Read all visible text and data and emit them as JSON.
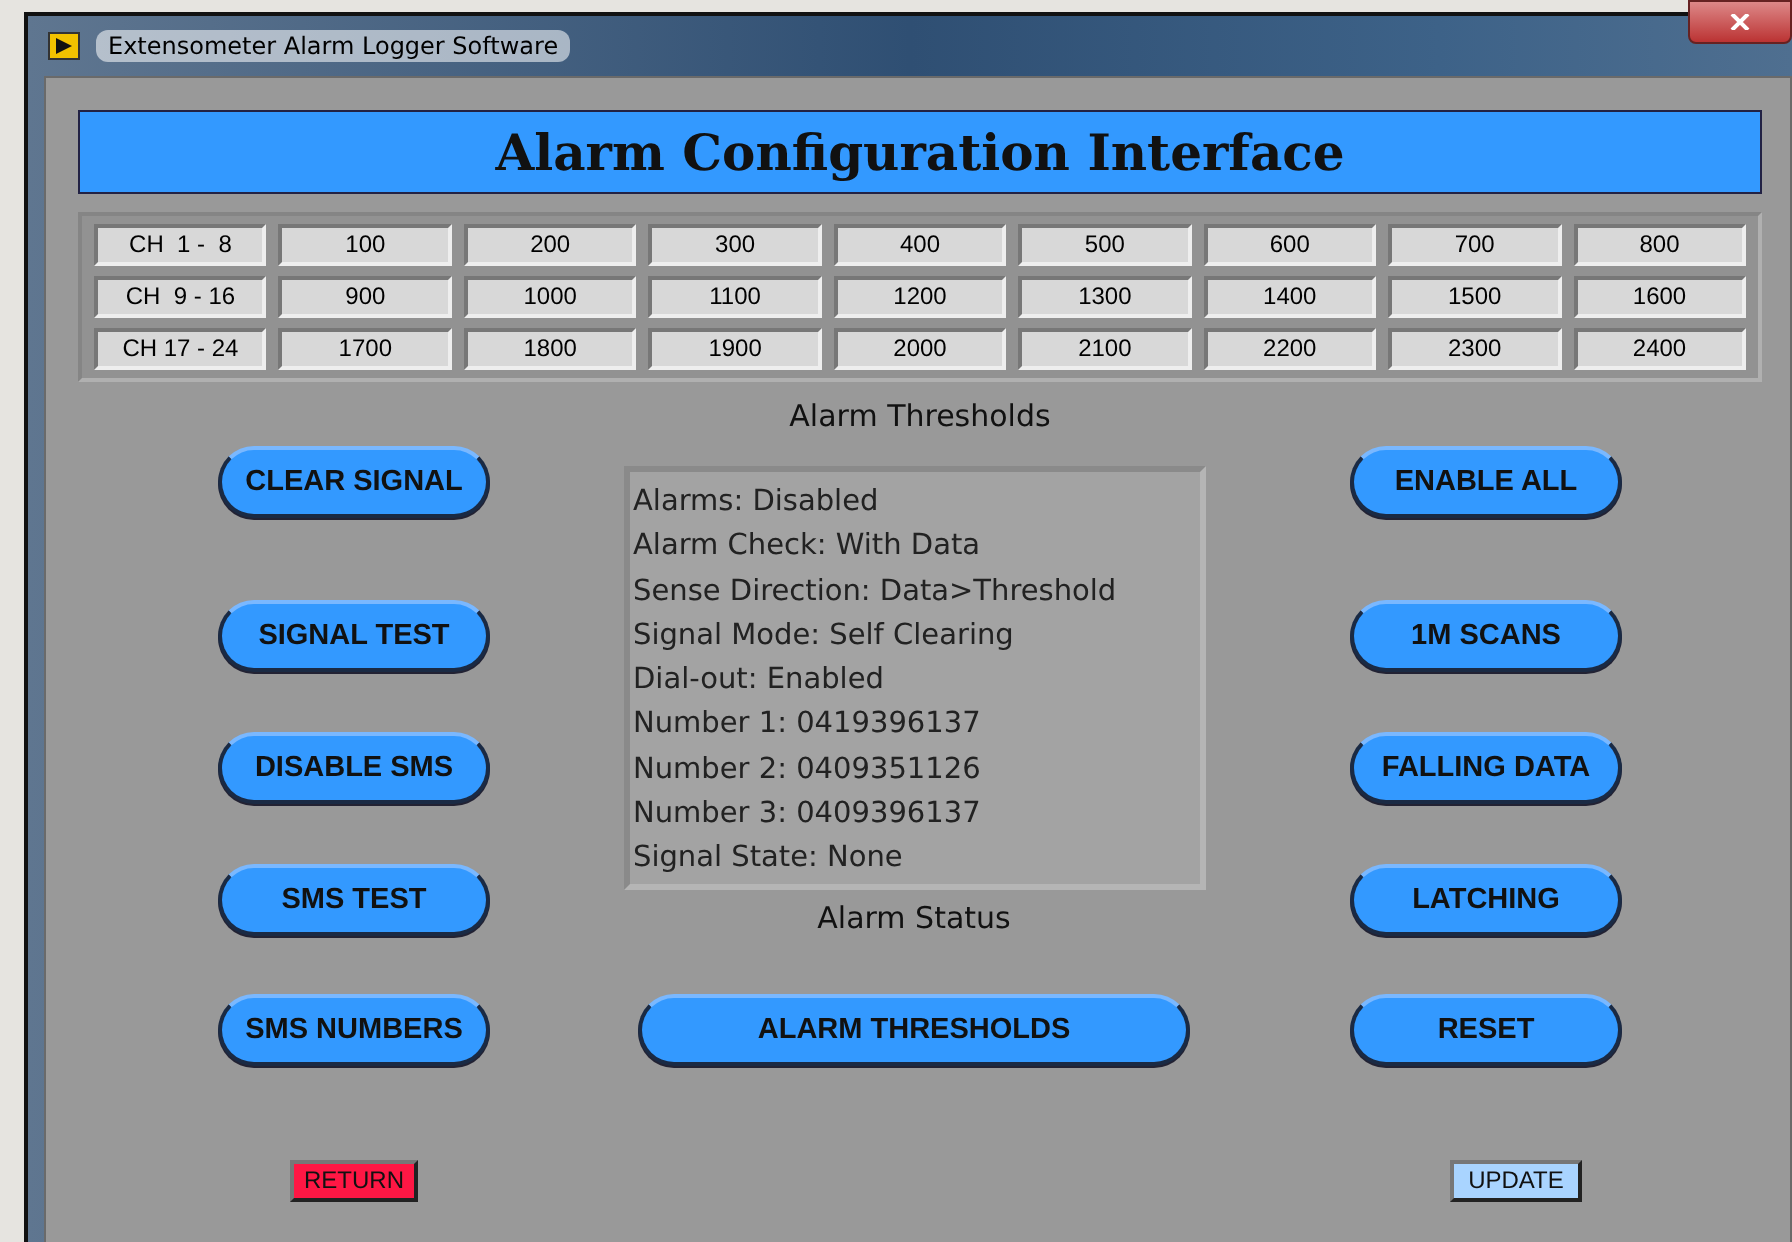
{
  "window": {
    "title": "Extensometer Alarm Logger Software"
  },
  "header": "Alarm Configuration Interface",
  "thresholds": {
    "rows": [
      {
        "label": "CH  1 -  8",
        "values": [
          "100",
          "200",
          "300",
          "400",
          "500",
          "600",
          "700",
          "800"
        ]
      },
      {
        "label": "CH  9 - 16",
        "values": [
          "900",
          "1000",
          "1100",
          "1200",
          "1300",
          "1400",
          "1500",
          "1600"
        ]
      },
      {
        "label": "CH 17 - 24",
        "values": [
          "1700",
          "1800",
          "1900",
          "2000",
          "2100",
          "2200",
          "2300",
          "2400"
        ]
      }
    ],
    "caption": "Alarm Thresholds"
  },
  "left_buttons": [
    "CLEAR SIGNAL",
    "SIGNAL TEST",
    "DISABLE SMS",
    "SMS TEST",
    "SMS NUMBERS"
  ],
  "status": {
    "lines": [
      "Alarms: Disabled",
      "Alarm Check: With Data",
      "Sense Direction: Data>Threshold",
      "Signal Mode: Self Clearing",
      "Dial-out: Enabled",
      "Number 1: 0419396137",
      "Number 2: 0409351126",
      "Number 3: 0409396137",
      "Signal State: None"
    ],
    "caption": "Alarm Status"
  },
  "center_button": "ALARM THRESHOLDS",
  "right_buttons": [
    "ENABLE ALL",
    "1M SCANS",
    "FALLING DATA",
    "LATCHING",
    "RESET"
  ],
  "return_button": "RETURN",
  "update_button": "UPDATE"
}
